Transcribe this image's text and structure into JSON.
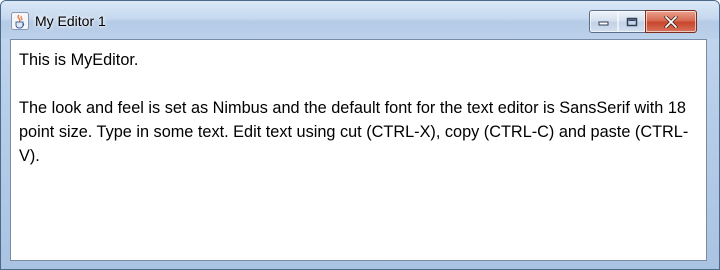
{
  "window": {
    "title": "My Editor 1",
    "app_icon": "java-cup-icon",
    "controls": {
      "minimize": "minimize-icon",
      "maximize": "maximize-icon",
      "close": "close-icon"
    },
    "colors": {
      "close": "#c7462c",
      "frame": "#b7cee9"
    }
  },
  "editor": {
    "line1": "This is MyEditor.",
    "paragraph": "The look and feel is set as Nimbus and the default font for the text editor is SansSerif with 18 point size. Type in some text. Edit text using cut (CTRL-X), copy (CTRL-C) and paste (CTRL-V)."
  }
}
